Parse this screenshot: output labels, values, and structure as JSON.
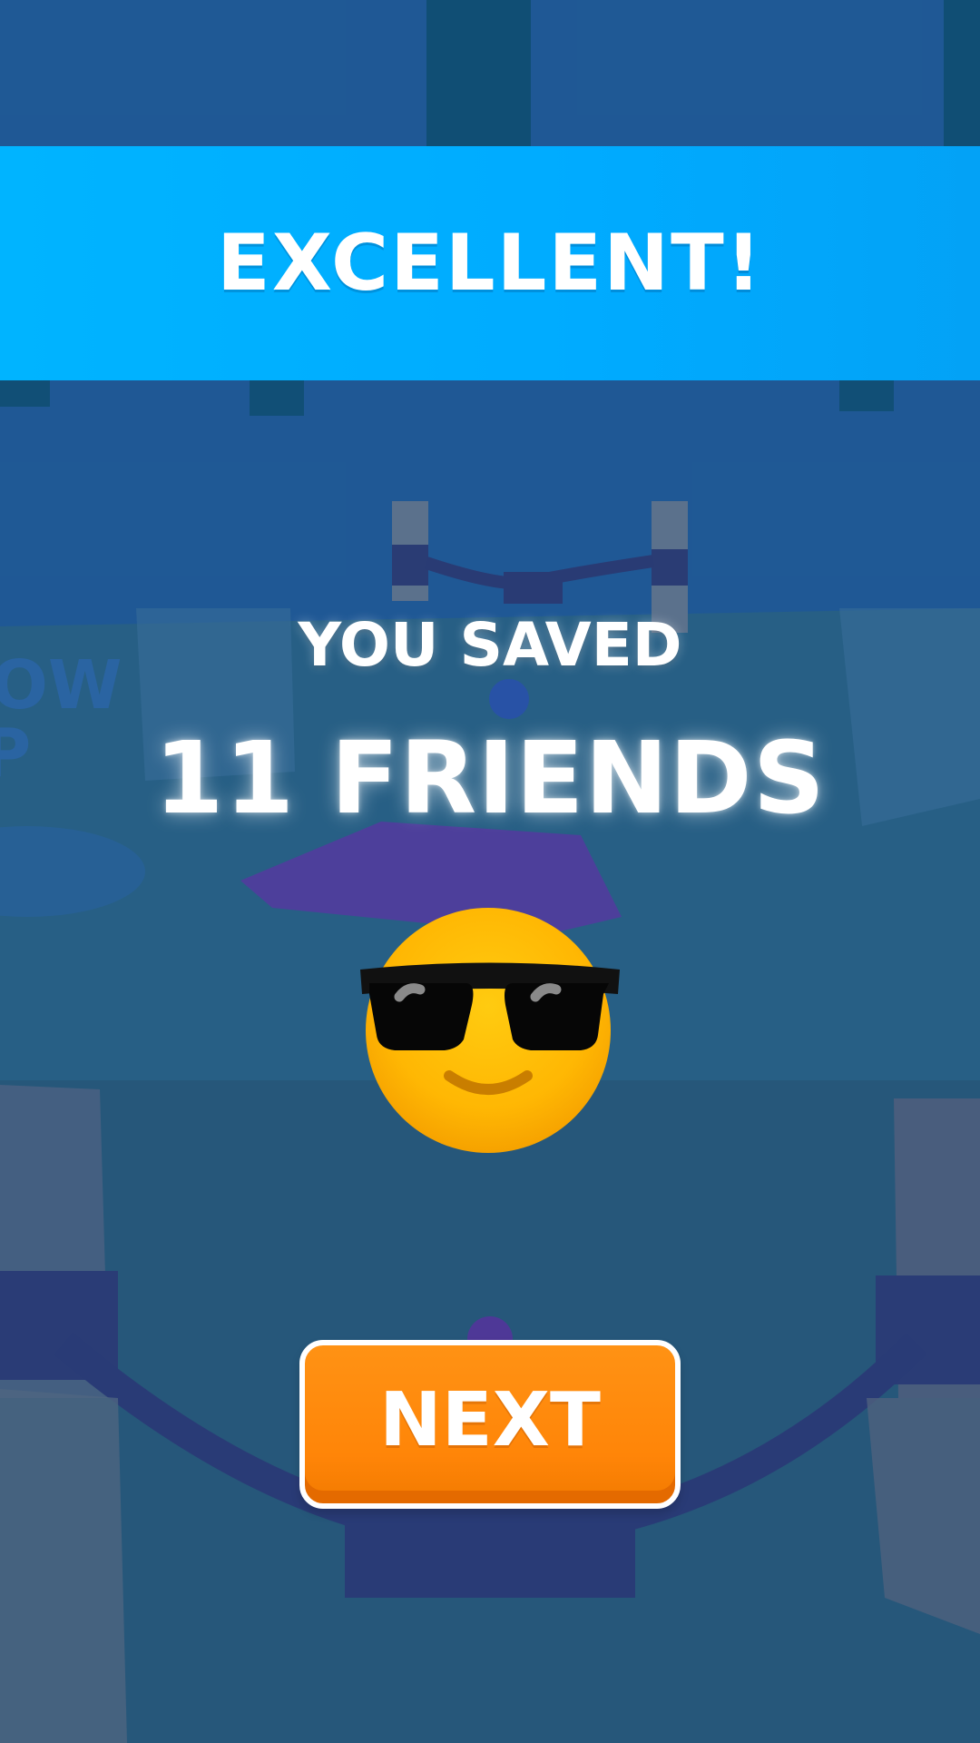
{
  "banner": {
    "title": "EXCELLENT!"
  },
  "result": {
    "saved_label": "YOU SAVED",
    "count_label": "11 FRIENDS"
  },
  "emoji": {
    "icon": "smiling-face-with-sunglasses-icon"
  },
  "buttons": {
    "next_label": "NEXT"
  },
  "background_scene": {
    "sign_text": "OW\nP"
  },
  "colors": {
    "banner": "#00b4ff",
    "button": "#ff8508",
    "button_border": "#ffffff",
    "text": "#ffffff",
    "emoji_face": "#ffb703",
    "background": "#2a6e98"
  }
}
